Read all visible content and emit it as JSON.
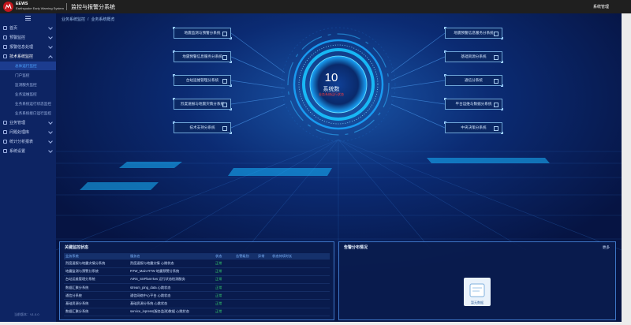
{
  "header": {
    "brand_name": "EEWS",
    "brand_sub": "Earthquake Early Warning System",
    "app_title": "监控与报警分系统",
    "user_label": "系统管理"
  },
  "sidebar": {
    "items": [
      {
        "label": "首页",
        "state": "collapsed"
      },
      {
        "label": "预警监控",
        "state": "collapsed"
      },
      {
        "label": "报警信息处理",
        "state": "collapsed"
      },
      {
        "label": "技术系统监控",
        "state": "expanded"
      },
      {
        "label": "业务管理",
        "state": "collapsed"
      },
      {
        "label": "问题处理库",
        "state": "collapsed"
      },
      {
        "label": "统计分析报表",
        "state": "collapsed"
      },
      {
        "label": "系统设置",
        "state": "collapsed"
      }
    ],
    "subitems": [
      {
        "label": "总体运行监控",
        "active": true
      },
      {
        "label": "门户监控",
        "active": false
      },
      {
        "label": "监测服务监控",
        "active": false
      },
      {
        "label": "业务运维监控",
        "active": false
      },
      {
        "label": "业务系统运行状态监控",
        "active": false
      },
      {
        "label": "业务系统接口运行监控",
        "active": false
      }
    ],
    "version": "当前版本：V1.0.0"
  },
  "breadcrumb": [
    "业务系统监控",
    "业务系统概览"
  ],
  "subsystems_left": [
    "地震监测与预警分系统",
    "地震预警信息服务分系统",
    "台站运维管理分系统",
    "烈度速报与地震灾情分系统",
    "技术支持分系统"
  ],
  "subsystems_right": [
    "地震预警信息服务分系统",
    "基础资源分系统",
    "通信分系统",
    "平台运维与数据分系统",
    "中央决策分系统"
  ],
  "hub": {
    "count": "10",
    "label": "系统数",
    "sub": "业务系统运行状态"
  },
  "status_panel": {
    "title": "关键监控状态",
    "columns": [
      "业务系统",
      "服务名",
      "状态",
      "告警级别",
      "异常",
      "状态持续时长"
    ],
    "rows": [
      [
        "烈度速报与地震灾情分系统",
        "烈度速报与地震灾情 心跳状态",
        "正常",
        "",
        "",
        ""
      ],
      [
        "地震监测与预警分系统",
        "RTW_Main-RTW 地震预警分系统",
        "正常",
        "",
        "",
        ""
      ],
      [
        "台站运维管理分系统",
        "AIRS_SSPlant-kes 运行状态检测服务",
        "正常",
        "",
        "",
        ""
      ],
      [
        "数据汇聚分系统",
        "stream_ping_data 心跳状态",
        "正常",
        "",
        "",
        ""
      ],
      [
        "通信分系统",
        "通信网络中心平台 心跳状态",
        "正常",
        "",
        "",
        ""
      ],
      [
        "基础资源分系统",
        "基础资源分系统 心跳状态",
        "正常",
        "",
        "",
        ""
      ],
      [
        "数据汇聚分系统",
        "service_inpress(服务监测)数据 心跳状态",
        "正常",
        "",
        "",
        ""
      ]
    ]
  },
  "alarm_panel": {
    "title": "告警分布情况",
    "more_label": "更多",
    "empty_text": "暂无数据"
  },
  "colors": {
    "header_bg": "#1f1f1f",
    "sidebar_bg": "#0d2463",
    "main_bg": "#07174a",
    "accent": "#4da3ff",
    "ok": "#35d16b",
    "warn_red": "#ff3b3b"
  }
}
